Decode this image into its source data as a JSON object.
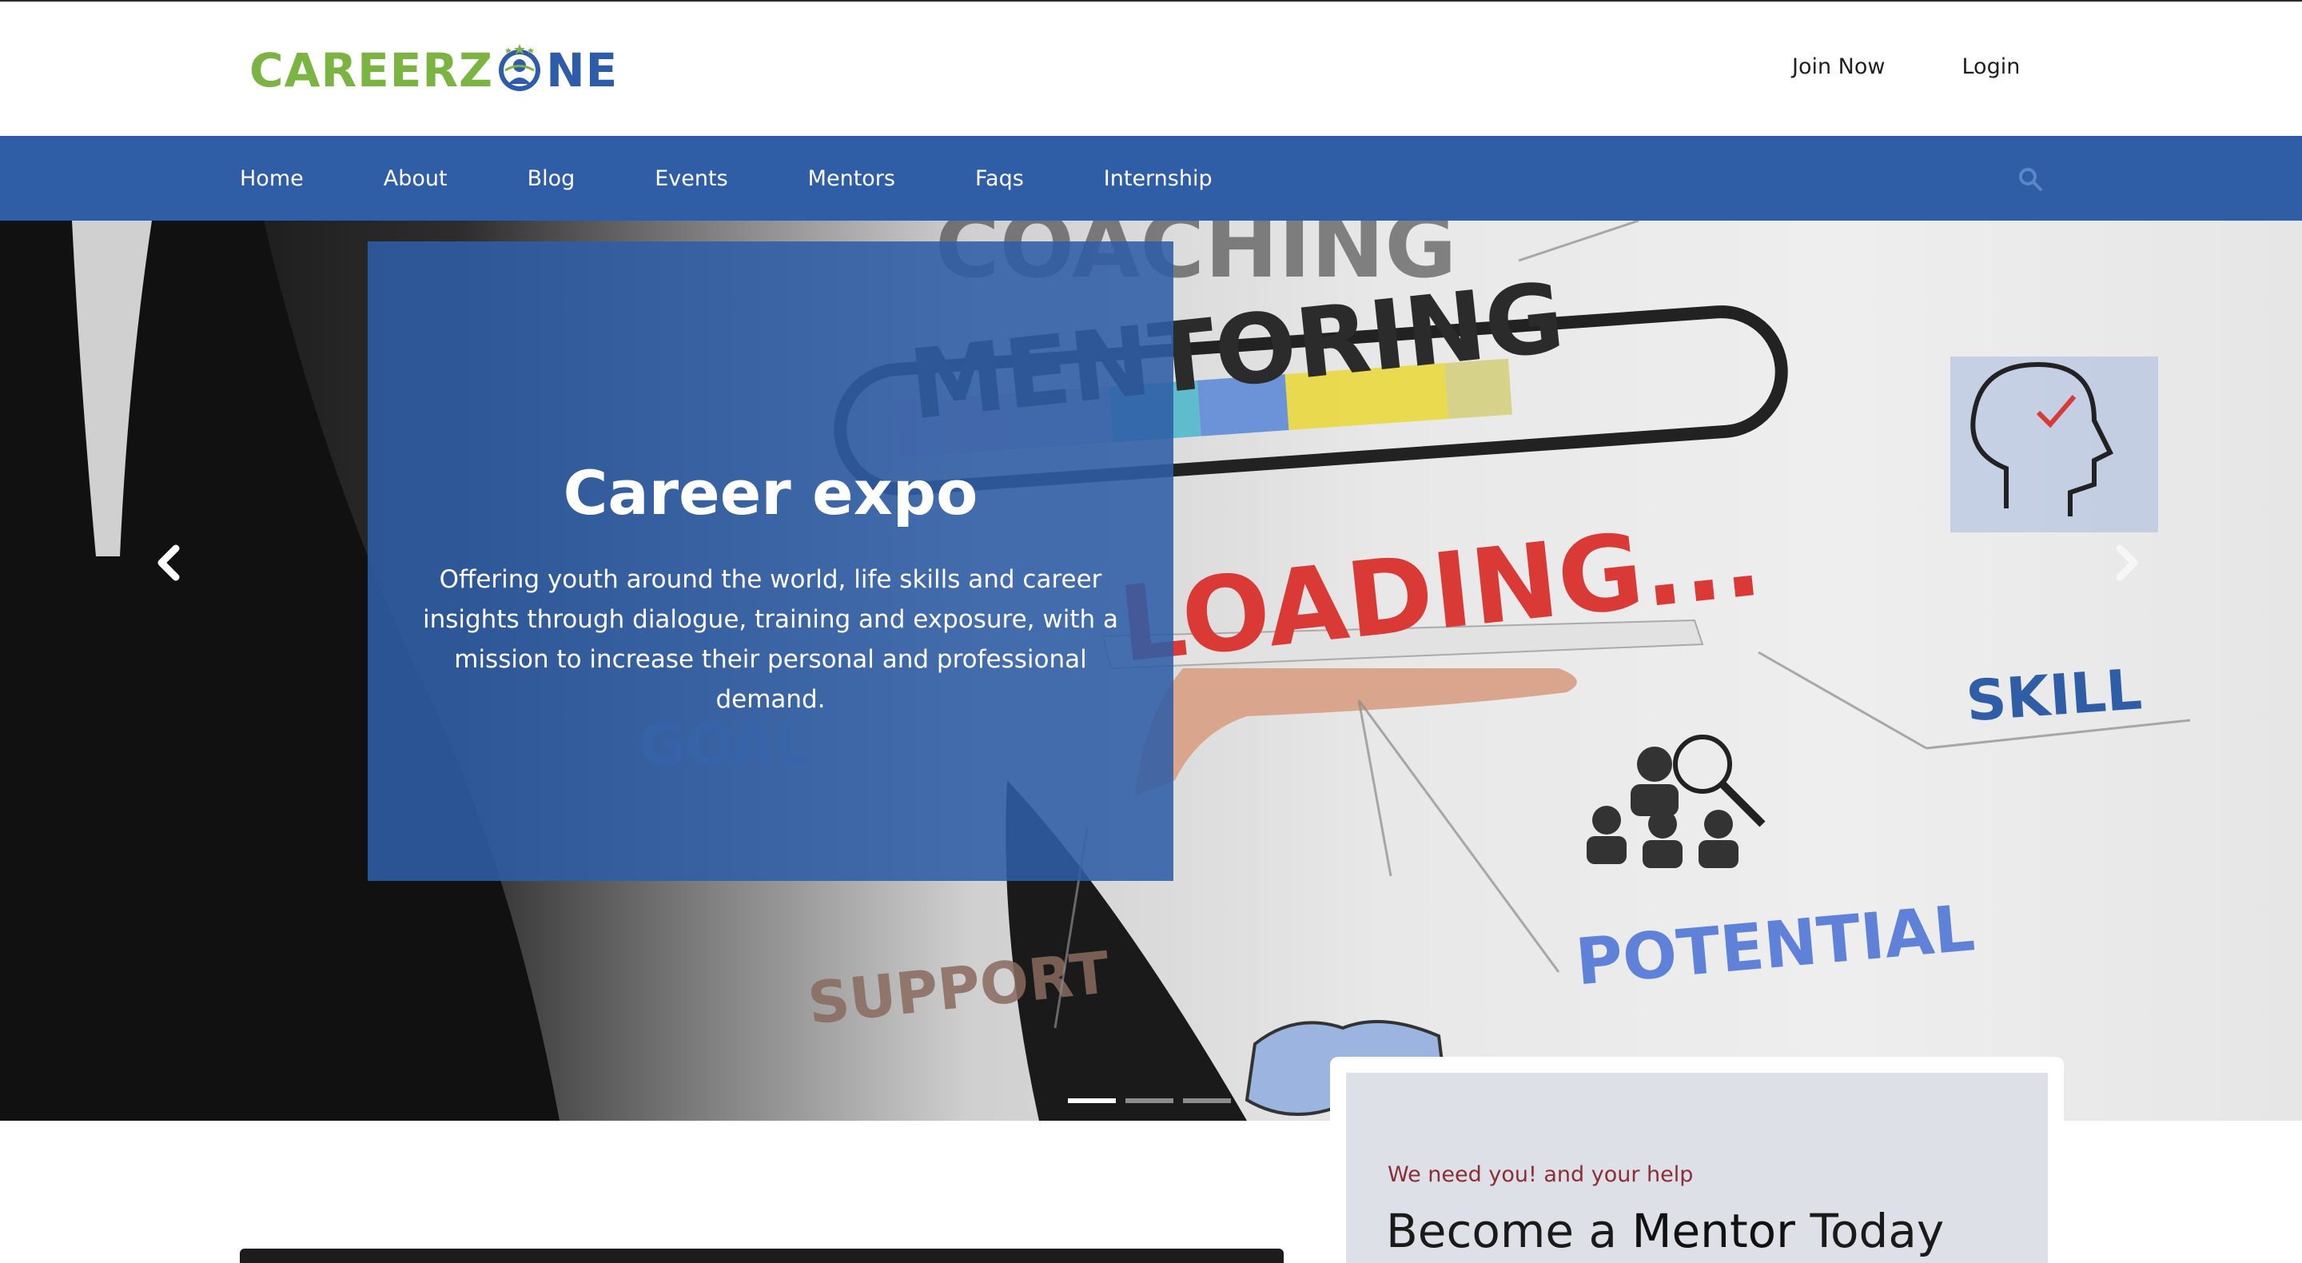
{
  "header": {
    "logo_part1": "CAREERZ",
    "logo_part2": "NE",
    "links": [
      "Join Now",
      "Login"
    ]
  },
  "nav": {
    "items": [
      "Home",
      "About",
      "Blog",
      "Events",
      "Mentors",
      "Faqs",
      "Internship"
    ],
    "search_icon": "search-icon"
  },
  "hero": {
    "title": "Career expo",
    "text": "Offering youth around the world, life skills and career insights through dialogue, training and exposure, with a mission to increase their personal and professional demand.",
    "background_words": [
      "COACHING",
      "MENTORING",
      "LOADING...",
      "GOAL",
      "SKILL",
      "POTENTIAL",
      "SUPPORT"
    ],
    "prev_icon": "chevron-left-icon",
    "next_icon": "chevron-right-icon",
    "slides": 3,
    "active_slide": 1
  },
  "mentor": {
    "kicker": "We need you! and your help",
    "title_a": "Become a ",
    "title_b": "Mentor",
    "title_c": " Today"
  },
  "colors": {
    "brand_blue": "#2f5da6",
    "brand_green": "#7bb443",
    "accent_red": "#8a2e35"
  }
}
